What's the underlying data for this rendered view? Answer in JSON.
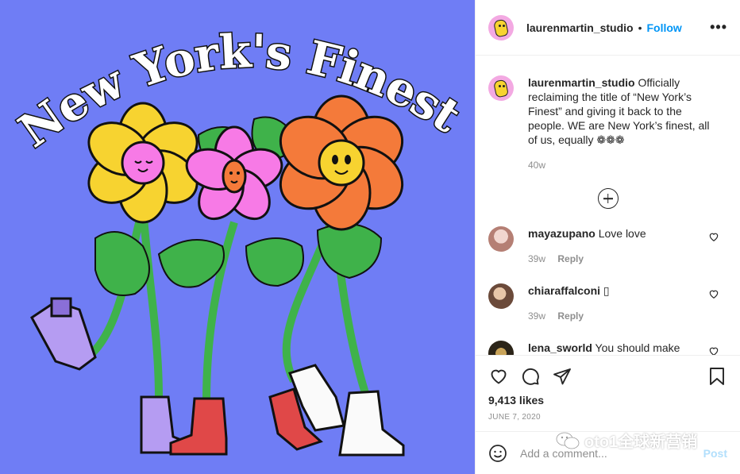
{
  "colors": {
    "background": "#6f7df5",
    "accent": "#0095f6",
    "muted": "#8e8e8e",
    "post_disabled": "#b2dffc"
  },
  "post_image": {
    "title": "New York's Finest"
  },
  "header": {
    "username": "laurenmartin_studio",
    "separator": "•",
    "follow_label": "Follow",
    "more_label": "•••"
  },
  "caption": {
    "username": "laurenmartin_studio",
    "text": " Officially reclaiming the title of “New York’s Finest” and giving it back to the people. WE are New York’s finest, all of us, equally ❁❁❁",
    "time": "40w"
  },
  "comments": [
    {
      "username": "mayazupano",
      "text": " Love love",
      "time": "39w",
      "reply_label": "Reply",
      "avatar_color": "#d9a9a0"
    },
    {
      "username": "chiaraffalconi",
      "text": " ▯",
      "time": "39w",
      "reply_label": "Reply",
      "avatar_color": "#c9a07a"
    },
    {
      "username": "lena_sworld",
      "text": " You should make",
      "time": "",
      "reply_label": "",
      "avatar_color": "#3a3020"
    }
  ],
  "actions": {
    "likes": "9,413 likes",
    "date": "JUNE 7, 2020",
    "icons": [
      "heart-icon",
      "comment-icon",
      "share-icon",
      "bookmark-icon"
    ]
  },
  "add_comment": {
    "placeholder": "Add a comment...",
    "post_label": "Post"
  },
  "watermark": {
    "text": "oto1全球新营销"
  }
}
